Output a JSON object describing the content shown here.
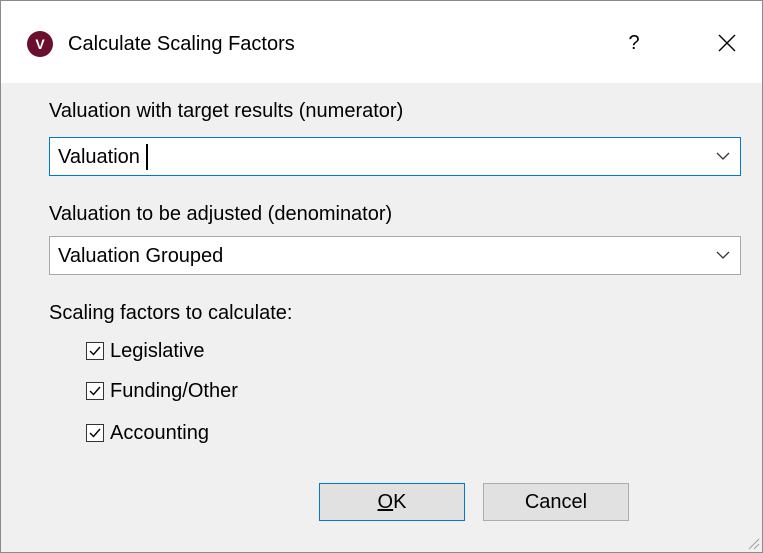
{
  "dialog": {
    "title": "Calculate Scaling Factors",
    "app_icon_letter": "V",
    "help_label": "?"
  },
  "numerator": {
    "label": "Valuation with target results (numerator)",
    "value": "Valuation"
  },
  "denominator": {
    "label": "Valuation to be adjusted (denominator)",
    "value": "Valuation Grouped"
  },
  "scaling": {
    "label": "Scaling factors to calculate:",
    "options": [
      {
        "label": "Legislative",
        "checked": true
      },
      {
        "label": "Funding/Other",
        "checked": true
      },
      {
        "label": "Accounting",
        "checked": true
      }
    ]
  },
  "buttons": {
    "ok_mnemonic": "O",
    "ok_rest": "K",
    "cancel": "Cancel"
  },
  "colors": {
    "accent": "#0078d7",
    "app_icon": "#6b0f2e"
  }
}
